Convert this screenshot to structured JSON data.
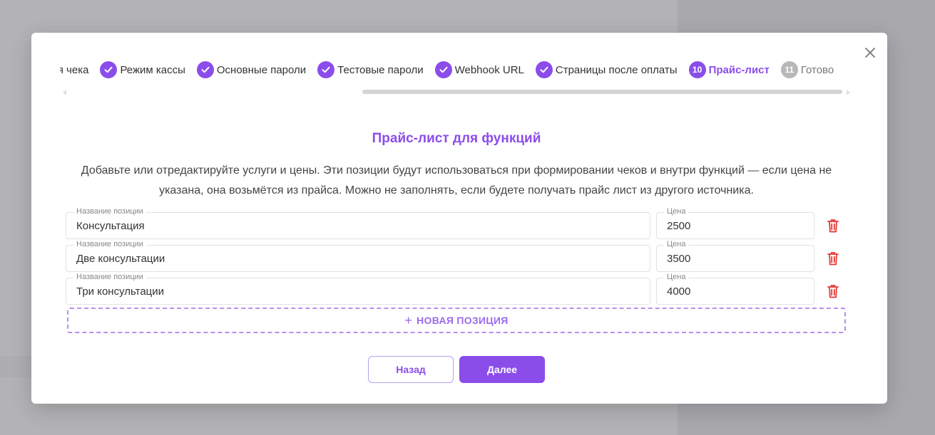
{
  "stepper": {
    "steps": [
      {
        "label": "ля чека",
        "state": "partial"
      },
      {
        "label": "Режим кассы",
        "state": "done"
      },
      {
        "label": "Основные пароли",
        "state": "done"
      },
      {
        "label": "Тестовые пароли",
        "state": "done"
      },
      {
        "label": "Webhook URL",
        "state": "done"
      },
      {
        "label": "Страницы после оплаты",
        "state": "done"
      },
      {
        "label": "Прайс-лист",
        "number": "10",
        "state": "active"
      },
      {
        "label": "Готово",
        "number": "11",
        "state": "pending"
      }
    ]
  },
  "dialog": {
    "title": "Прайс-лист для функций",
    "description": "Добавьте или отредактируйте услуги и цены. Эти позиции будут использоваться при формировании чеков и внутри функций — если цена не указана, она возьмётся из прайса. Можно не заполнять, если будете получать прайс лист из другого источника."
  },
  "items": [
    {
      "name_label": "Название позиции",
      "name": "Консультация",
      "price_label": "Цена",
      "price": "2500"
    },
    {
      "name_label": "Название позиции",
      "name": "Две консультации",
      "price_label": "Цена",
      "price": "3500"
    },
    {
      "name_label": "Название позиции",
      "name": "Три консультации",
      "price_label": "Цена",
      "price": "4000"
    }
  ],
  "add_button": {
    "label": "НОВАЯ ПОЗИЦИЯ"
  },
  "buttons": {
    "back": "Назад",
    "next": "Далее"
  },
  "colors": {
    "accent": "#8b4dea",
    "danger": "#e53935",
    "pending": "#b8b8b8"
  }
}
